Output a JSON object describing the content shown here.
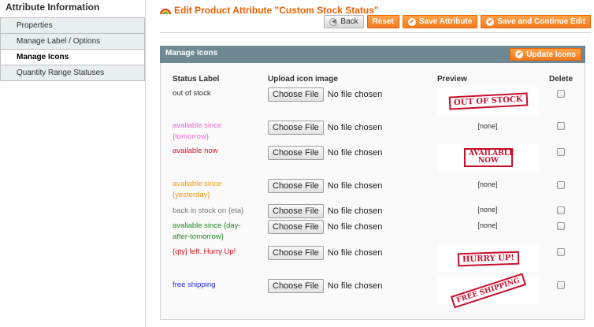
{
  "sidebar": {
    "title": "Attribute Information",
    "tabs": [
      {
        "label": "Properties",
        "active": false
      },
      {
        "label": "Manage Label / Options",
        "active": false
      },
      {
        "label": "Manage Icons",
        "active": true
      },
      {
        "label": "Quantity Range Statuses",
        "active": false
      }
    ]
  },
  "header": {
    "title": "Edit Product Attribute \"Custom Stock Status\"",
    "buttons": {
      "back": "Back",
      "reset": "Reset",
      "save": "Save Attribute",
      "save_continue": "Save and Continue Edit"
    }
  },
  "fieldset": {
    "title": "Manage Icons",
    "update_button": "Update Icons",
    "columns": {
      "status_label": "Status Label",
      "upload": "Upload icon image",
      "preview": "Preview",
      "delete": "Delete"
    },
    "choose_file_label": "Choose File",
    "no_file_label": "No file chosen",
    "rows": [
      {
        "label": "out of stock",
        "label_color": "#2f2f2f",
        "preview": "OUT OF STOCK",
        "preview_type": "image"
      },
      {
        "label": "avaliable since {tomorrow}",
        "label_color": "#e86ad2",
        "preview": "[none]",
        "preview_type": "none"
      },
      {
        "label": "available now",
        "label_color": "#d1141b",
        "preview": "AVAILABLE NOW",
        "preview_type": "image"
      },
      {
        "label": "avaliable since {yesterday}",
        "label_color": "#f39b13",
        "preview": "[none]",
        "preview_type": "none"
      },
      {
        "label": "back in stock on {eta}",
        "label_color": "#777777",
        "preview": "[none]",
        "preview_type": "none"
      },
      {
        "label": "avaliable since {day-after-tomorrow}",
        "label_color": "#1e8a1e",
        "preview": "[none]",
        "preview_type": "none"
      },
      {
        "label": "{qty} left. Hurry Up!",
        "label_color": "#d1141b",
        "preview": "HURRY UP!",
        "preview_type": "image"
      },
      {
        "label": "free shipping",
        "label_color": "#1f2bd6",
        "preview": "FREE SHIPPING",
        "preview_type": "image"
      }
    ]
  },
  "colors": {
    "accent": "#eb5e00",
    "header_bar": "#6f8992",
    "button": "#f47b1e",
    "stamp_red": "#c8102e"
  }
}
